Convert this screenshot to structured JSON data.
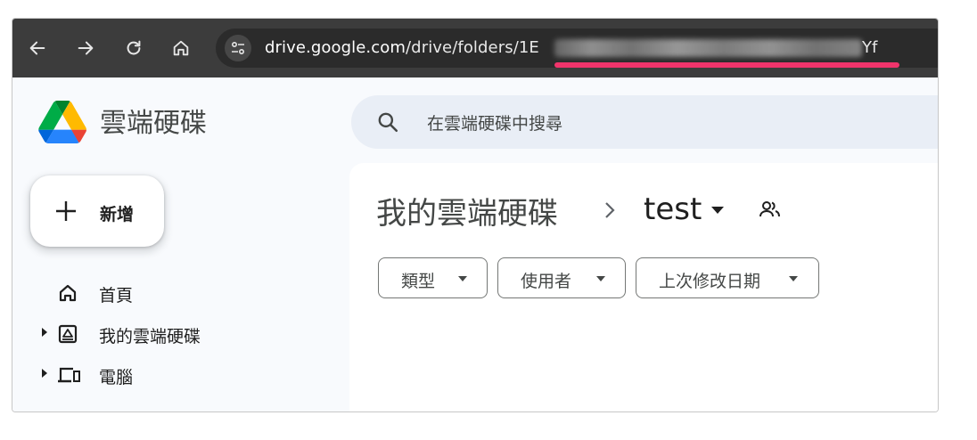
{
  "browser": {
    "url_host": "drive.google.com",
    "url_path": "/drive/folders/1E",
    "url_tail": "Yf",
    "nav": [
      "back-arrow-icon",
      "forward-arrow-icon",
      "reload-icon",
      "home-icon"
    ]
  },
  "app": {
    "name": "雲端硬碟",
    "search_placeholder": "在雲端硬碟中搜尋",
    "new_label": "新增"
  },
  "sidebar": {
    "items": [
      {
        "label": "首頁",
        "icon": "home-icon"
      },
      {
        "label": "我的雲端硬碟",
        "icon": "my-drive-icon"
      },
      {
        "label": "電腦",
        "icon": "computers-icon"
      }
    ]
  },
  "breadcrumb": {
    "root": "我的雲端硬碟",
    "current": "test"
  },
  "filters": [
    {
      "label": "類型"
    },
    {
      "label": "使用者"
    },
    {
      "label": "上次修改日期"
    }
  ],
  "colors": {
    "toolbar": "#3c3c3c",
    "url_highlight": "#f0346b",
    "app_bg": "#f8fafd",
    "search_bg": "#e9eef6"
  }
}
